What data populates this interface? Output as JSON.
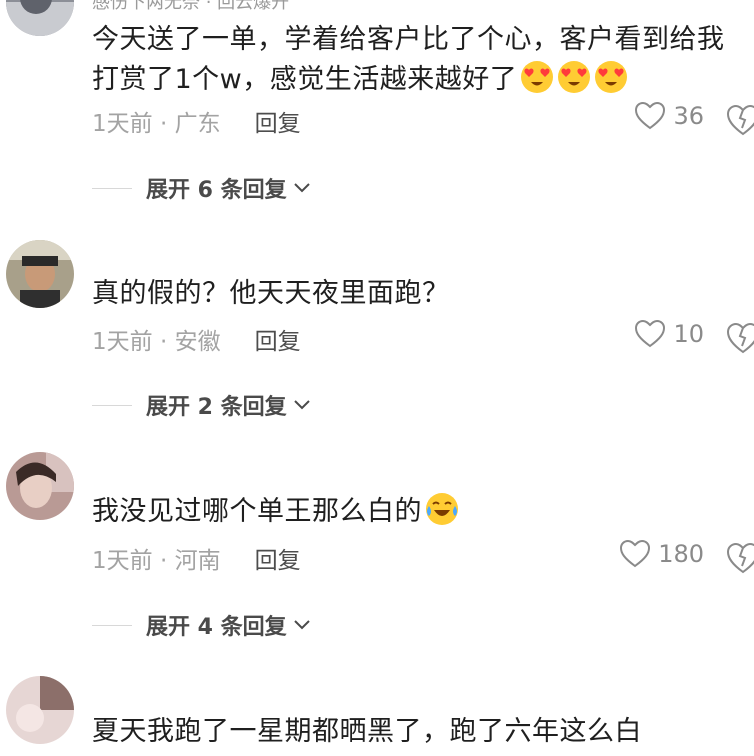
{
  "comments": [
    {
      "username": "感伤下两无奈 · 回云爆开",
      "text": "今天送了一单，学着给客户比了个心，客户看到给我打赏了1个w，感觉生活越来越好了",
      "emoji": "heart-eyes",
      "meta": "1天前 · 广东",
      "reply": "回复",
      "likes": "36",
      "expand": "展开 6 条回复"
    },
    {
      "username": "",
      "text": "真的假的？他天天夜里面跑？",
      "emoji": "",
      "meta": "1天前 · 安徽",
      "reply": "回复",
      "likes": "10",
      "expand": "展开 2 条回复"
    },
    {
      "username": "",
      "text": "我没见过哪个单王那么白的",
      "emoji": "tears-of-joy",
      "meta": "1天前 · 河南",
      "reply": "回复",
      "likes": "180",
      "expand": "展开 4 条回复"
    },
    {
      "username": "",
      "text": "夏天我跑了一星期都晒黑了，跑了六年这么白",
      "emoji": "",
      "meta": "",
      "reply": "",
      "likes": "",
      "expand": ""
    }
  ],
  "colors": {
    "text": "#1f1f1f",
    "meta": "#a3a3a3",
    "reply": "#4d4d4d",
    "emoji_face": "#ffcc33",
    "emoji_heart": "#ff3b3b"
  }
}
